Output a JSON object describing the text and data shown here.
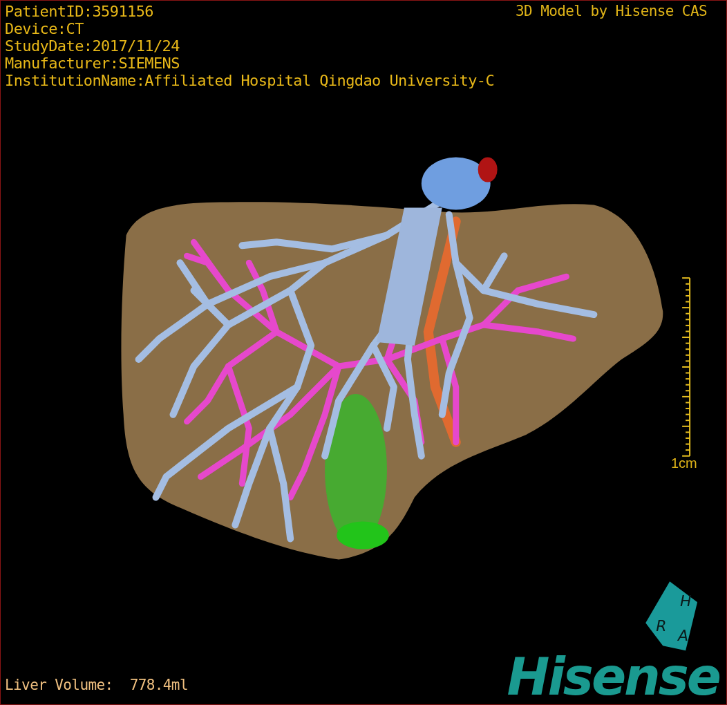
{
  "patient_info": [
    "PatientID:3591156",
    "Device:CT",
    "StudyDate:2017/11/24",
    "Manufacturer:SIEMENS",
    "InstitutionName:Affiliated Hospital Qingdao University-C"
  ],
  "credit": "3D Model by Hisense CAS",
  "scale_bar": {
    "label": "1cm"
  },
  "orientation_cube": {
    "faces": [
      "H",
      "R",
      "A"
    ]
  },
  "liver_volume": "Liver Volume:  778.4ml",
  "logo": "Hisense"
}
